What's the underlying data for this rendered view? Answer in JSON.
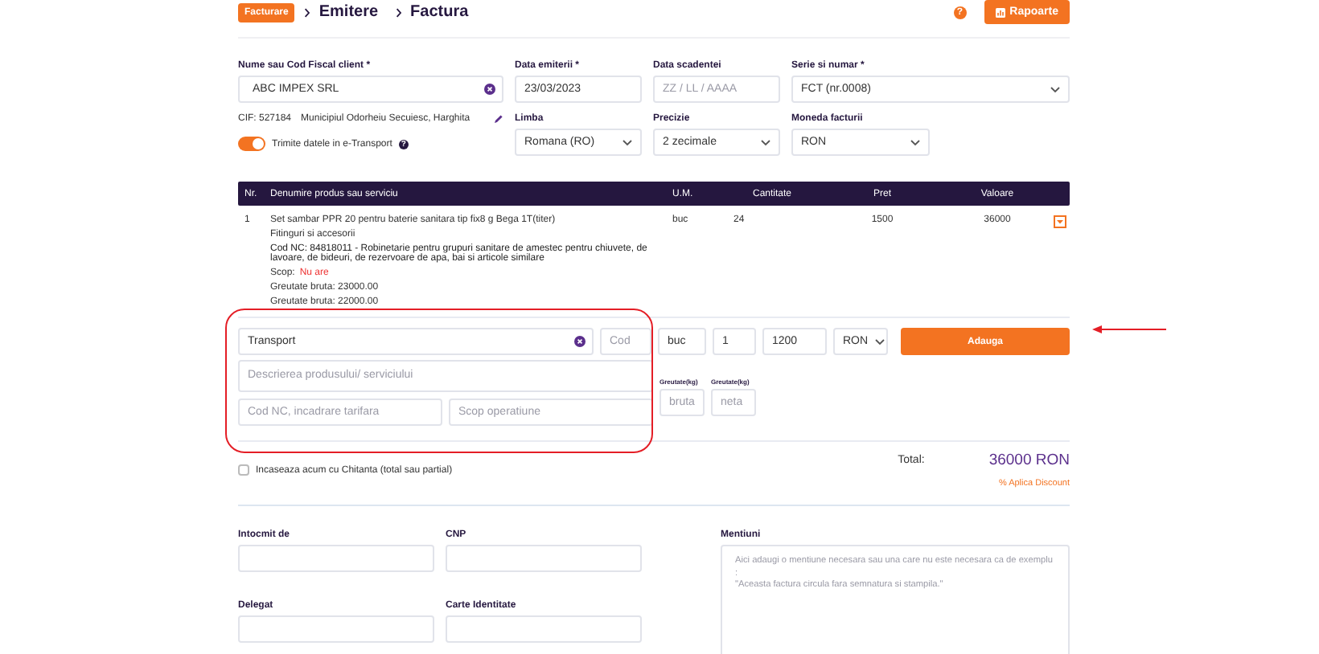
{
  "header": {
    "badge": "Facturare",
    "breadcrumb": [
      "Emitere",
      "Factura"
    ],
    "help": "?",
    "reports_button": "Rapoarte"
  },
  "client": {
    "label": "Nume sau Cod Fiscal client *",
    "value": "ABC IMPEX SRL",
    "cif": "CIF: 527184",
    "address": "Municipiul Odorheiu Secuiesc, Harghita",
    "transport_toggle": {
      "label": "Trimite datele in e-Transport",
      "on": true,
      "help": "?"
    }
  },
  "fields": [
    {
      "kind": "date",
      "label": "Data emiterii *",
      "value": "23/03/2023"
    },
    {
      "kind": "date",
      "label": "Data scadentei",
      "placeholder": "ZZ / LL / AAAA"
    },
    {
      "kind": "select",
      "label": "Serie si numar *",
      "value": "FCT (nr.0008)"
    },
    {
      "kind": "select",
      "label": "Limba",
      "value": "Romana (RO)"
    },
    {
      "kind": "select",
      "label": "Precizie",
      "value": "2 zecimale"
    },
    {
      "kind": "select",
      "label": "Moneda facturii",
      "value": "RON"
    }
  ],
  "table": {
    "columns": [
      "Nr.",
      "Denumire produs sau serviciu",
      "U.M.",
      "Cantitate",
      "Pret",
      "Valoare"
    ],
    "rows": [
      {
        "nr": "1",
        "name": "Set sambar PPR 20 pentru baterie sanitara tip fix8 g Bega 1T(titer)",
        "category": "Fitinguri si accesorii",
        "nc_code": "Cod NC: 84818011 - Robinetarie pentru grupuri sanitare de amestec pentru chiuvete, de lavoare, de bideuri, de rezervoare de apa, bai si articole similare",
        "scope_label": "Scop:",
        "scope_value": "Nu are",
        "gross_weight": "Greutate bruta: 23000.00",
        "net_weight": "Greutate bruta: 22000.00",
        "unit": "buc",
        "quantity": "24",
        "price": "1500",
        "value": "36000"
      }
    ]
  },
  "new_item": {
    "name": "Transport",
    "code_placeholder": "Cod",
    "unit": "buc",
    "quantity": "1",
    "price": "1200",
    "currency": "RON",
    "add_button": "Adauga",
    "description_placeholder": "Descrierea produsului/ serviciului",
    "nc_placeholder": "Cod NC, incadrare tarifara",
    "scope_placeholder": "Scop operatiune",
    "gross_label": "Greutate(kg)",
    "gross_placeholder": "bruta",
    "net_label": "Greutate(kg)",
    "net_placeholder": "neta"
  },
  "totals": {
    "paid_checkbox": {
      "label": "Incaseaza acum cu Chitanta (total sau partial)",
      "checked": false
    },
    "total_label": "Total:",
    "total_value": "36000 RON",
    "discount_link": "% Aplica Discount"
  },
  "footer": {
    "fields": [
      {
        "label": "Intocmit de"
      },
      {
        "label": "CNP"
      },
      {
        "label": "Delegat"
      },
      {
        "label": "Carte Identitate"
      }
    ],
    "notes": {
      "label": "Mentiuni",
      "placeholder": "Aici adaugi o mentiune necesara sau una care nu este necesara ca de exemplu :\n\"Aceasta factura circula fara semnatura si stampila.\""
    }
  }
}
